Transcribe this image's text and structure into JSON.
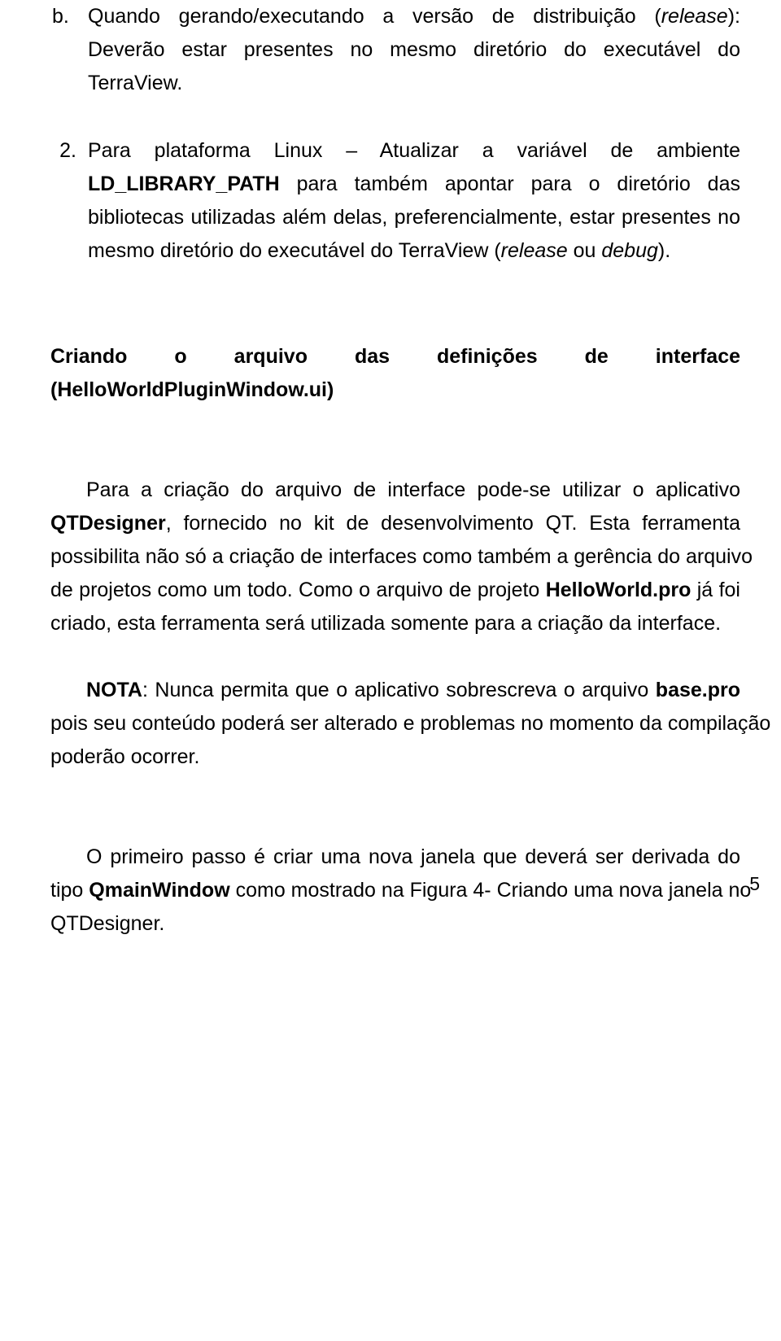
{
  "document": {
    "page_number": "5",
    "list_items": [
      {
        "marker": "b.",
        "line1_a": "Quando gerando/executando a versão de distribuição (",
        "line1_italic": "release",
        "line1_b": "):",
        "line2": "Deverão estar presentes no mesmo diretório do executável do",
        "line3": "TerraView."
      },
      {
        "marker": "2.",
        "line1": "Para plataforma Linux – Atualizar a variável de ambiente",
        "line2_bold": "LD_LIBRARY_PATH",
        "line2_rest": "para também apontar para o diretório das",
        "line3": "bibliotecas utilizadas além delas, preferencialmente, estar presentes no",
        "line4_a": "mesmo diretório do executável do TerraView (",
        "line4_italic_1": "release",
        "line4_mid": " ou ",
        "line4_italic_2": "debug",
        "line4_b": ")."
      }
    ],
    "section_heading": {
      "line1": "Criando o arquivo das definições de interface",
      "line2": "(HelloWorldPluginWindow.ui)"
    },
    "paragraph_qtdesigner": {
      "line1": "Para a criação do arquivo de interface pode-se utilizar o aplicativo",
      "line2_bold": "QTDesigner",
      "line2_rest": ", fornecido no kit de desenvolvimento QT. Esta ferramenta",
      "line3": "possibilita não só a criação de interfaces como também a gerência do arquivo",
      "line4_a": "de projetos como um todo. Como o arquivo de projeto ",
      "line4_bold": "HelloWorld.pro",
      "line4_b": " já foi",
      "line5": "criado, esta ferramenta será utilizada somente para a criação da interface."
    },
    "paragraph_nota": {
      "line1_bold": "NOTA",
      "line1_rest": ": Nunca permita que o aplicativo sobrescreva o arquivo ",
      "line1_bold2": "base.pro",
      "line2": "pois seu conteúdo poderá ser alterado e problemas no momento da compilação",
      "line3": "poderão ocorrer."
    },
    "paragraph_primeiro_passo": {
      "line1": "O primeiro passo é criar uma nova janela que deverá ser derivada do",
      "line2_a": "tipo ",
      "line2_bold": "QmainWindow",
      "line2_b": " como mostrado na Figura 4- Criando uma nova janela no",
      "line3": "QTDesigner."
    }
  }
}
